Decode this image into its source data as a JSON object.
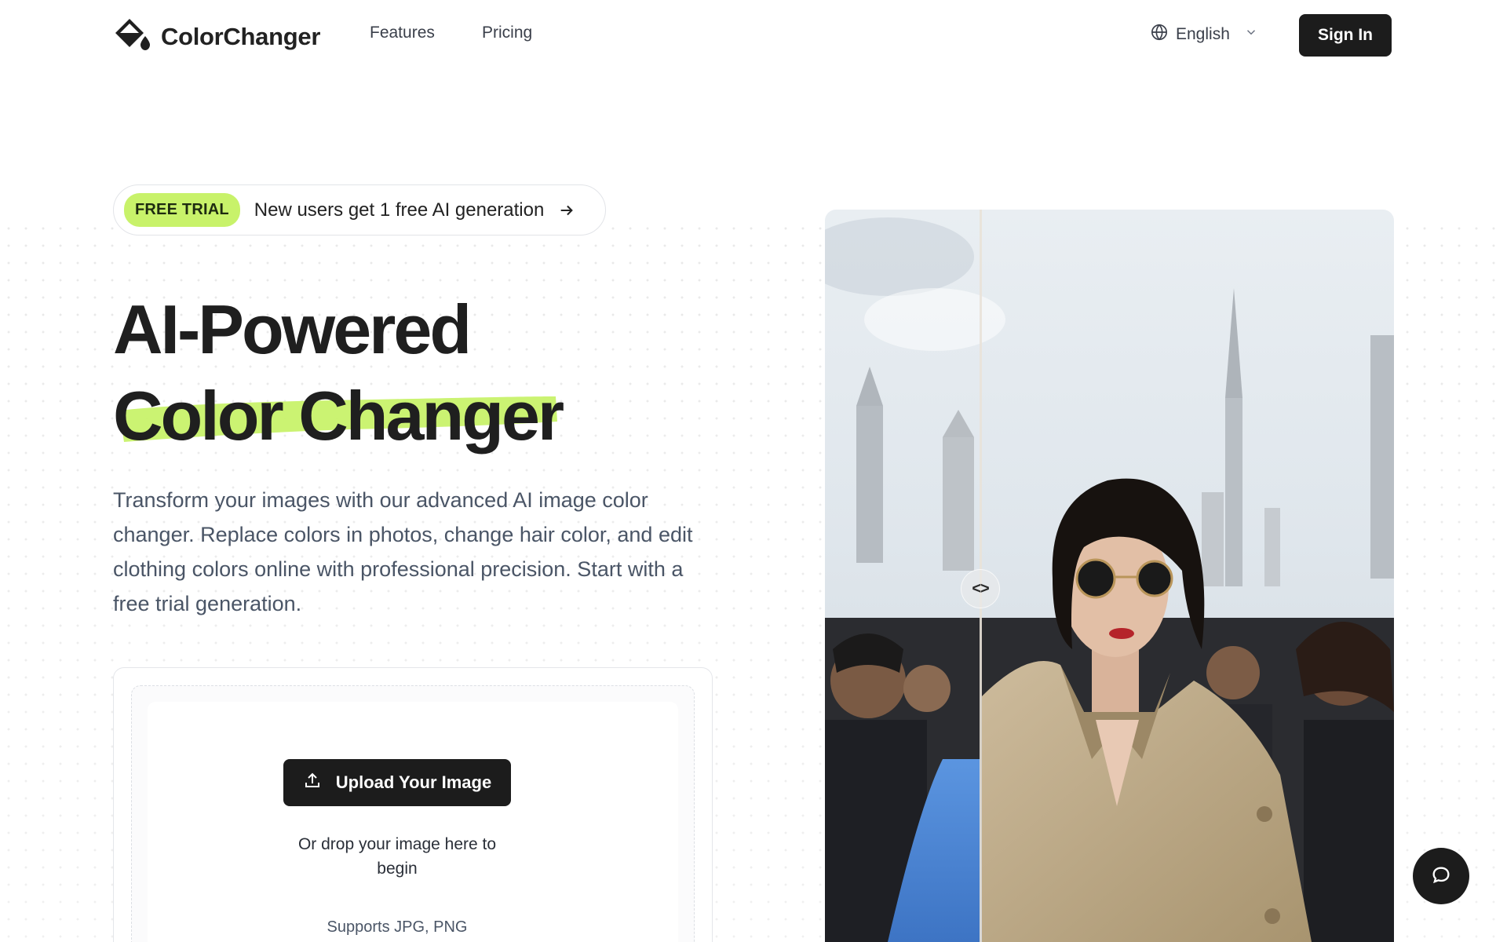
{
  "header": {
    "brand": "ColorChanger",
    "nav": {
      "features": "Features",
      "pricing": "Pricing"
    },
    "language": "English",
    "sign_in": "Sign In"
  },
  "trial": {
    "badge": "FREE TRIAL",
    "text": "New users get 1 free AI generation"
  },
  "hero": {
    "title_line1": "AI-Powered",
    "title_line2": "Color Changer",
    "description": "Transform your images with our advanced AI image color changer. Replace colors in photos, change hair color, and edit clothing colors online with professional precision. Start with a free trial generation."
  },
  "upload": {
    "button": "Upload Your Image",
    "drop_text": "Or drop your image here to begin",
    "supports": "Supports JPG, PNG"
  },
  "compare": {
    "slider_glyph": "<>"
  },
  "colors": {
    "accent": "#c8f26a",
    "dark": "#1c1c1c",
    "coat_before": "#4a86d6",
    "coat_after": "#bca98a"
  },
  "icons": {
    "brand": "paint-bucket-icon",
    "language": "globe-icon",
    "dropdown": "chevron-down-icon",
    "trial": "arrow-right-icon",
    "upload": "upload-icon",
    "chat": "chat-bubble-icon"
  }
}
